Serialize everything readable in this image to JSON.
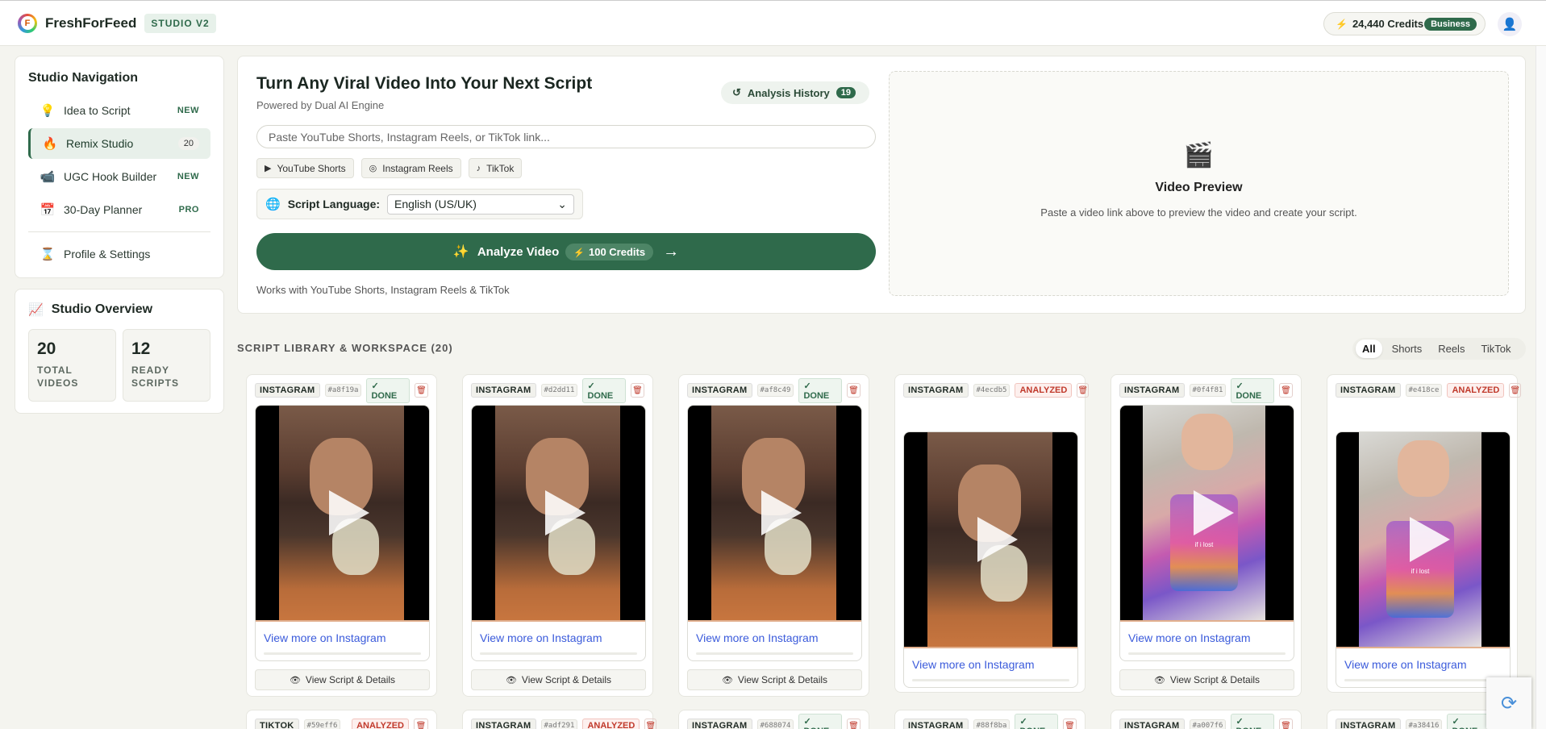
{
  "app": {
    "brand": "FreshForFeed",
    "logo_letter": "F",
    "version_badge": "STUDIO V2",
    "credits": "24,440 Credits",
    "plan": "Business",
    "accent_color": "#2f6a4b"
  },
  "nav": {
    "title": "Studio Navigation",
    "items": [
      {
        "label": "Idea to Script",
        "icon": "lightbulb-icon",
        "tag": "NEW"
      },
      {
        "label": "Remix Studio",
        "icon": "flame-icon",
        "tag": "20"
      },
      {
        "label": "UGC Hook Builder",
        "icon": "video-camera-icon",
        "tag": "NEW"
      },
      {
        "label": "30-Day Planner",
        "icon": "calendar-icon",
        "tag": "PRO"
      },
      {
        "label": "Profile & Settings",
        "icon": "hourglass-icon",
        "tag": ""
      }
    ]
  },
  "overview": {
    "title": "Studio Overview",
    "stats": [
      {
        "value": "20",
        "label_line1": "TOTAL",
        "label_line2": "VIDEOS"
      },
      {
        "value": "12",
        "label_line1": "READY",
        "label_line2": "SCRIPTS"
      }
    ]
  },
  "analyzer": {
    "title": "Turn Any Viral Video Into Your Next Script",
    "subtitle": "Powered by Dual AI Engine",
    "history_label": "Analysis History",
    "history_count": "19",
    "input_placeholder": "Paste YouTube Shorts, Instagram Reels, or TikTok link...",
    "chips": [
      "YouTube Shorts",
      "Instagram Reels",
      "TikTok"
    ],
    "language_label": "Script Language:",
    "language_value": "English (US/UK)",
    "analyze_label": "Analyze Video",
    "analyze_cost": "100 Credits",
    "note": "Works with YouTube Shorts, Instagram Reels & TikTok"
  },
  "preview": {
    "title": "Video Preview",
    "subtitle": "Paste a video link above to preview the video and create your script."
  },
  "library": {
    "title": "SCRIPT LIBRARY & WORKSPACE (20)",
    "filters": [
      "All",
      "Shorts",
      "Reels",
      "TikTok"
    ],
    "active_filter": "All",
    "link_label": "View more on Instagram",
    "details_label": "View Script & Details",
    "cards": [
      {
        "platform": "INSTAGRAM",
        "id": "#a8f19a",
        "status": "✓ DONE",
        "status_type": "done",
        "caption": ""
      },
      {
        "platform": "INSTAGRAM",
        "id": "#d2dd11",
        "status": "✓ DONE",
        "status_type": "done",
        "caption": ""
      },
      {
        "platform": "INSTAGRAM",
        "id": "#af8c49",
        "status": "✓ DONE",
        "status_type": "done",
        "caption": ""
      },
      {
        "platform": "INSTAGRAM",
        "id": "#4ecdb5",
        "status": "ANALYZED",
        "status_type": "analyzed",
        "caption": ""
      },
      {
        "platform": "INSTAGRAM",
        "id": "#0f4f81",
        "status": "✓ DONE",
        "status_type": "done",
        "caption": "if i lost"
      },
      {
        "platform": "INSTAGRAM",
        "id": "#e418ce",
        "status": "ANALYZED",
        "status_type": "analyzed",
        "caption": "if i lost"
      }
    ],
    "row2": [
      {
        "platform": "TIKTOK",
        "id": "#59eff6",
        "status": "ANALYZED",
        "status_type": "analyzed"
      },
      {
        "platform": "INSTAGRAM",
        "id": "#adf291",
        "status": "ANALYZED",
        "status_type": "analyzed"
      },
      {
        "platform": "INSTAGRAM",
        "id": "#688074",
        "status": "✓ DONE",
        "status_type": "done"
      },
      {
        "platform": "INSTAGRAM",
        "id": "#88f8ba",
        "status": "✓ DONE",
        "status_type": "done"
      },
      {
        "platform": "INSTAGRAM",
        "id": "#a007f6",
        "status": "✓ DONE",
        "status_type": "done"
      },
      {
        "platform": "INSTAGRAM",
        "id": "#a38416",
        "status": "✓ DONE",
        "status_type": "done"
      }
    ]
  }
}
